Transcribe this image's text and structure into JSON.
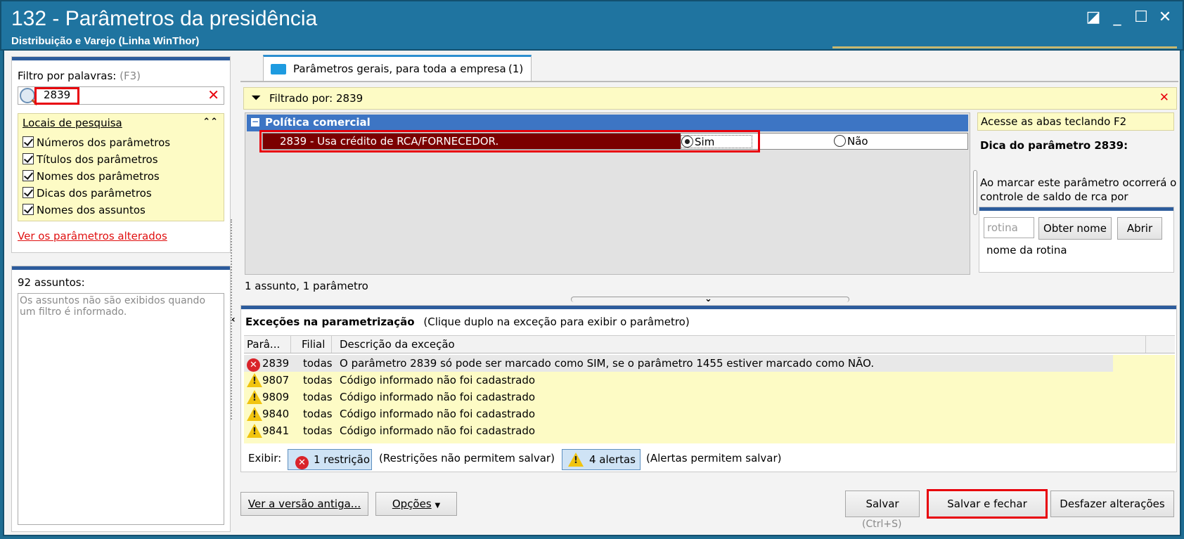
{
  "window": {
    "title": "132 - Parâmetros da presidência",
    "subtitle": "Distribuição e Varejo (Linha WinThor)",
    "controls": [
      "◪",
      "_",
      "☐",
      "✕"
    ]
  },
  "filter": {
    "label": "Filtro por palavras:",
    "shortcut": "(F3)",
    "value": "2839",
    "search_places_title": "Locais de pesquisa",
    "options": [
      "Números dos parâmetros",
      "Títulos dos parâmetros",
      "Nomes dos parâmetros",
      "Dicas dos parâmetros",
      "Nomes dos assuntos"
    ],
    "changed_link": "Ver os parâmetros alterados"
  },
  "subjects": {
    "count_label": "92 assuntos:",
    "note": "Os assuntos não são exibidos quando um filtro é informado."
  },
  "tab": {
    "label": "Parâmetros gerais, para toda a empresa",
    "count": "(1)"
  },
  "filtered_by": "Filtrado por: 2839",
  "group": {
    "title": "Política comercial",
    "param_label": "2839 - Usa crédito de RCA/FORNECEDOR.",
    "option_yes": "Sim",
    "option_no": "Não",
    "selected": "Sim"
  },
  "summary": "1 assunto, 1 parâmetro",
  "hint": {
    "access_tabs": "Acesse as abas teclando F2",
    "title": "Dica do parâmetro 2839:",
    "text": "Ao marcar este parâmetro ocorrerá o controle de saldo de rca por",
    "routine_placeholder": "rotina",
    "get_name_btn": "Obter nome",
    "open_btn": "Abrir",
    "routine_name": "nome da rotina"
  },
  "exceptions": {
    "title": "Exceções na parametrização",
    "subtitle": "(Clique duplo na exceção para exibir o parâmetro)",
    "columns": [
      "Parâ...",
      "Filial",
      "Descrição da exceção"
    ],
    "rows": [
      {
        "type": "error",
        "param": "2839",
        "branch": "todas",
        "desc": "O parâmetro 2839 só pode ser marcado como SIM, se o parâmetro 1455 estiver marcado como NÃO."
      },
      {
        "type": "warning",
        "param": "9807",
        "branch": "todas",
        "desc": "Código informado não foi cadastrado"
      },
      {
        "type": "warning",
        "param": "9809",
        "branch": "todas",
        "desc": "Código informado não foi cadastrado"
      },
      {
        "type": "warning",
        "param": "9840",
        "branch": "todas",
        "desc": "Código informado não foi cadastrado"
      },
      {
        "type": "warning",
        "param": "9841",
        "branch": "todas",
        "desc": "Código informado não foi cadastrado"
      }
    ],
    "show_label": "Exibir:",
    "restrictions_btn": "1 restrição",
    "restrictions_note": "(Restrições não permitem salvar)",
    "alerts_btn": "4 alertas",
    "alerts_note": "(Alertas permitem salvar)"
  },
  "footer": {
    "old_version": "Ver a versão antiga...",
    "options": "Opções",
    "save": "Salvar",
    "save_shortcut": "(Ctrl+S)",
    "save_close": "Salvar e fechar",
    "undo": "Desfazer alterações"
  },
  "colors": {
    "title_bg": "#1f74a0",
    "group_header": "#3d75c4",
    "selected_row": "#7b0000",
    "highlight": "#e8000b",
    "yellow": "#fdfbc5"
  }
}
